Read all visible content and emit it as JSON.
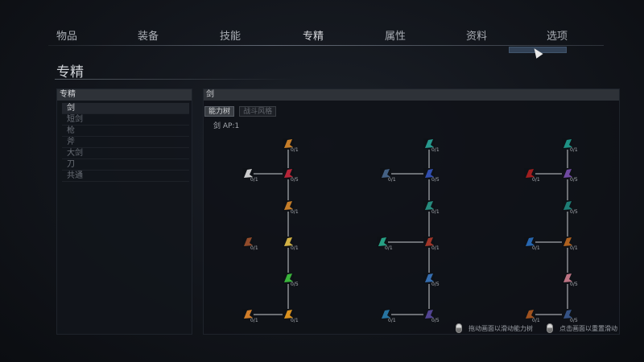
{
  "nav": {
    "tabs": [
      {
        "label": "物品"
      },
      {
        "label": "装备"
      },
      {
        "label": "技能"
      },
      {
        "label": "专精"
      },
      {
        "label": "属性"
      },
      {
        "label": "资料"
      },
      {
        "label": "选项"
      }
    ],
    "active_index": 3
  },
  "page": {
    "title": "专精"
  },
  "left_panel": {
    "header": "专精",
    "items": [
      {
        "label": "剑",
        "active": true
      },
      {
        "label": "短剑"
      },
      {
        "label": "枪"
      },
      {
        "label": "斧"
      },
      {
        "label": "大剑"
      },
      {
        "label": "刀"
      },
      {
        "label": "共通"
      }
    ]
  },
  "right_panel": {
    "header": "剑",
    "subtabs": [
      {
        "label": "能力树",
        "active": true
      },
      {
        "label": "战斗风格"
      }
    ],
    "ap_label": "剑 AP:1"
  },
  "tree": {
    "nodes": [
      {
        "id": "a1",
        "icon": "sword-slash-icon",
        "color": "#d98a2b",
        "count": "0/1"
      },
      {
        "id": "a2",
        "icon": "sword-thrust-icon",
        "color": "#e0e0e0",
        "count": "0/1"
      },
      {
        "id": "a3",
        "icon": "crimson-blade-icon",
        "color": "#c8283c",
        "count": "0/5"
      },
      {
        "id": "a4",
        "icon": "rising-slash-icon",
        "color": "#d98a2b",
        "count": "0/1"
      },
      {
        "id": "a5",
        "icon": "boots-icon",
        "color": "#a0522d",
        "count": "0/1"
      },
      {
        "id": "a6",
        "icon": "gold-shield-icon",
        "color": "#e8c34a",
        "count": "0/1"
      },
      {
        "id": "a7",
        "icon": "green-burst-icon",
        "color": "#3fc63f",
        "count": "0/5"
      },
      {
        "id": "a8",
        "icon": "orange-slash-icon",
        "color": "#e58a2b",
        "count": "0/1"
      },
      {
        "id": "a9",
        "icon": "fire-slash-icon",
        "color": "#f0a020",
        "count": "0/1"
      },
      {
        "id": "b1",
        "icon": "teal-hook-icon",
        "color": "#2aa79a",
        "count": "0/1"
      },
      {
        "id": "b2",
        "icon": "dark-blade-icon",
        "color": "#4a6a90",
        "count": "0/1"
      },
      {
        "id": "b3",
        "icon": "blue-gem-icon",
        "color": "#3555c0",
        "count": "0/5"
      },
      {
        "id": "b4",
        "icon": "teal-arc-icon",
        "color": "#2a9a8a",
        "count": "0/1"
      },
      {
        "id": "b5",
        "icon": "teal-wing-icon",
        "color": "#2ab090",
        "count": "0/1"
      },
      {
        "id": "b6",
        "icon": "red-beast-icon",
        "color": "#b03a2a",
        "count": "0/1"
      },
      {
        "id": "b7",
        "icon": "blue-dash-icon",
        "color": "#3a78c0",
        "count": "0/5"
      },
      {
        "id": "b8",
        "icon": "blue-line-icon",
        "color": "#2a80b0",
        "count": "0/1"
      },
      {
        "id": "b9",
        "icon": "purple-orb-icon",
        "color": "#5a4aa0",
        "count": "0/5"
      },
      {
        "id": "c1",
        "icon": "teal-curve-icon",
        "color": "#20a090",
        "count": "0/1"
      },
      {
        "id": "c2",
        "icon": "red-ring-icon",
        "color": "#b02020",
        "count": "0/1"
      },
      {
        "id": "c3",
        "icon": "purple-swirl-icon",
        "color": "#7a50b0",
        "count": "0/5"
      },
      {
        "id": "c4",
        "icon": "teal-spiral-icon",
        "color": "#208a80",
        "count": "0/5"
      },
      {
        "id": "c5",
        "icon": "blue-wind-icon",
        "color": "#2a70c0",
        "count": "0/1"
      },
      {
        "id": "c6",
        "icon": "orange-fist-icon",
        "color": "#c06a20",
        "count": "0/1"
      },
      {
        "id": "c7",
        "icon": "pink-cross-icon",
        "color": "#d08090",
        "count": "0/5"
      },
      {
        "id": "c8",
        "icon": "orange-beast-icon",
        "color": "#b05a20",
        "count": "0/1"
      },
      {
        "id": "c9",
        "icon": "navy-crest-icon",
        "color": "#3a5a90",
        "count": "0/5"
      }
    ]
  },
  "hints": [
    {
      "icon": "mouse-left-icon",
      "text": "拖动画面以滑动能力树"
    },
    {
      "icon": "mouse-right-icon",
      "text": "点击画面以重置滑动"
    }
  ]
}
